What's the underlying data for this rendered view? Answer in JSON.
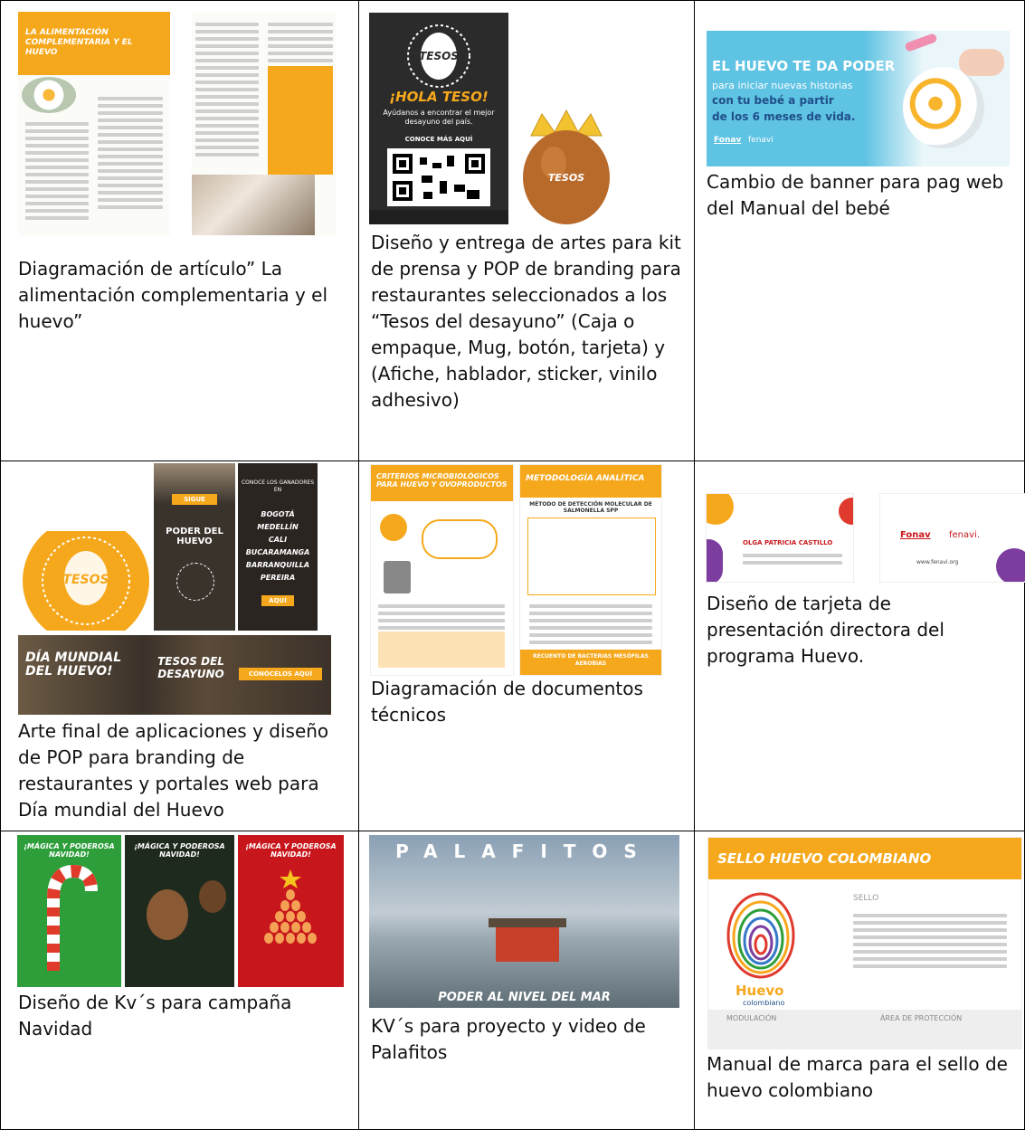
{
  "cells": {
    "article": {
      "caption": "Diagramación de artículo” La alimentación complementaria y el huevo”",
      "header": "LA ALIMENTACIÓN COMPLEMENTARIA Y EL HUEVO"
    },
    "tesos_kit": {
      "caption": "Diseño y entrega de artes para kit de prensa y POP de branding para restaurantes seleccionados a los “Tesos del desayuno” (Caja o empaque, Mug, botón, tarjeta) y (Afiche, hablador, sticker, vinilo adhesivo)",
      "poster_title": "¡HOLA TESO!",
      "poster_sub": "Ayúdanos a encontrar el mejor desayuno del país.",
      "poster_cta": "CONOCE MÁS AQUÍ",
      "egg_logo": "TESOS DEL DESAYUNO."
    },
    "banner": {
      "caption": "Cambio de banner para pag web del Manual del bebé",
      "headline": "EL HUEVO TE DA PODER",
      "line1": "para iniciar nuevas historias",
      "line2": "con tu bebé a partir",
      "line3": "de los 6 meses de vida.",
      "brand1": "Fonav",
      "brand2": "fenavi"
    },
    "dia_mundial": {
      "caption": "Arte final de aplicaciones y diseño de POP para branding de restaurantes y portales web para Día mundial del Huevo",
      "circle_logo": "TESOS DEL DESAYUNO.",
      "sigue": "SIGUE",
      "poder": "PODER DEL HUEVO",
      "conoce": "CONOCE LOS GANADORES EN",
      "cities": [
        "BOGOTÁ",
        "MEDELLÍN",
        "CALI",
        "BUCARAMANGA",
        "BARRANQUILLA",
        "PEREIRA"
      ],
      "aqui": "AQUÍ",
      "banner_left": "DÍA MUNDIAL DEL HUEVO!",
      "banner_mid": "TESOS DEL DESAYUNO",
      "banner_right": "CONÓCELOS AQUÍ"
    },
    "docs": {
      "caption": "Diagramación de documentos técnicos",
      "doc1_title": "CRITERIOS MICROBIOLÓGICOS PARA HUEVO Y OVOPRODUCTOS",
      "doc2_title": "METODOLOGÍA ANALÍTICA",
      "doc2_sub": "MÉTODO DE DETECCIÓN MOLECULAR DE SALMONELLA SPP",
      "doc2_footer": "RECUENTO DE BACTERIAS MESÓFILAS AEROBIAS"
    },
    "tarjeta": {
      "caption": "Diseño de tarjeta de presentación directora del programa Huevo.",
      "name": "OLGA PATRICIA CASTILLO",
      "brand1": "Fonav",
      "brand2": "fenavi.",
      "web": "www.fenavi.org"
    },
    "navidad": {
      "caption": "Diseño de Kv´s para campaña Navidad",
      "title": "¡MÁGICA Y PODEROSA NAVIDAD!"
    },
    "palafitos": {
      "caption": "KV´s para proyecto y video de Palafitos",
      "title": "PALAFITOS",
      "tagline": "PODER AL NIVEL DEL MAR"
    },
    "sello": {
      "caption": "Manual de marca para el sello de huevo colombiano",
      "title": "SELLO HUEVO COLOMBIANO",
      "section": "SELLO",
      "logo_word": "Huevo",
      "logo_sub": "colombiano",
      "mod": "MODULACIÓN",
      "area": "ÁREA DE PROTECCIÓN"
    }
  },
  "colors": {
    "orange": "#f6a81c",
    "dark": "#2b2b2b",
    "green": "#2e9e3b",
    "red": "#c8171c",
    "blue": "#5fc3e3"
  }
}
